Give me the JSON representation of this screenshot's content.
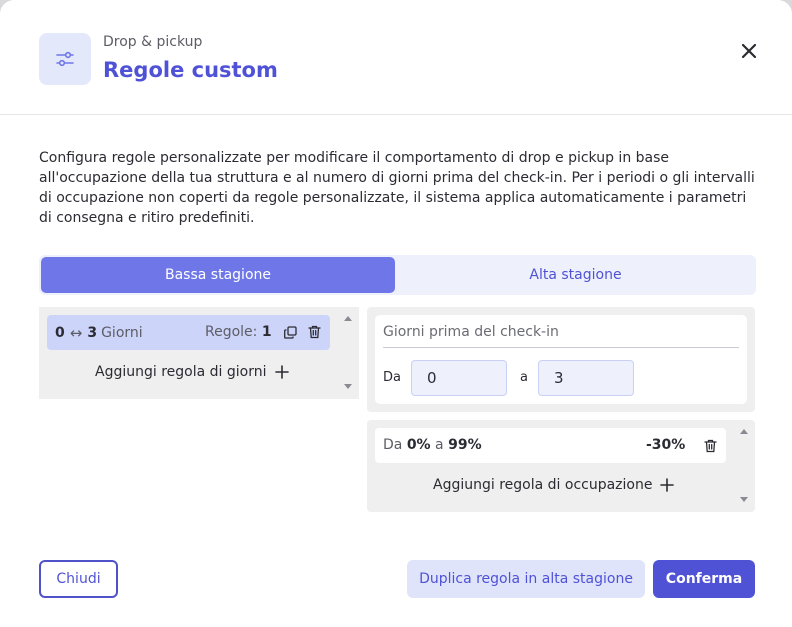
{
  "header": {
    "subtitle": "Drop & pickup",
    "title": "Regole custom"
  },
  "description": "Configura regole personalizzate per modificare il comportamento di drop e pickup in base all'occupazione della tua struttura e al numero di giorni prima del check-in. Per i periodi o gli intervalli di occupazione non coperti da regole personalizzate, il sistema applica automaticamente i parametri di consegna e ritiro predefiniti.",
  "tabs": [
    {
      "label": "Bassa stagione",
      "active": true
    },
    {
      "label": "Alta stagione",
      "active": false
    }
  ],
  "day_rules": {
    "items": [
      {
        "from": "0",
        "arrow": "↔",
        "to": "3",
        "unit": "Giorni",
        "rules_label": "Regole:",
        "rules_count": "1"
      }
    ],
    "add_label": "Aggiungi regola di giorni"
  },
  "days_editor": {
    "label": "Giorni prima del check-in",
    "from_label": "Da",
    "from_value": "0",
    "to_label": "a",
    "to_value": "3"
  },
  "occupancy_rules": {
    "items": [
      {
        "prefix": "Da",
        "from": "0%",
        "sep": "a",
        "to": "99%",
        "discount": "-30%"
      }
    ],
    "add_label": "Aggiungi regola di occupazione"
  },
  "footer": {
    "close_label": "Chiudi",
    "duplicate_label": "Duplica regola in alta stagione",
    "confirm_label": "Conferma"
  },
  "colors": {
    "accent": "#4f52d6",
    "active_tab": "#6f77e8",
    "selected_rule": "#ccd4fa",
    "panel_bg": "#efefef"
  },
  "icons": [
    "sliders-icon",
    "close-icon",
    "copy-icon",
    "trash-icon",
    "plus-icon"
  ]
}
